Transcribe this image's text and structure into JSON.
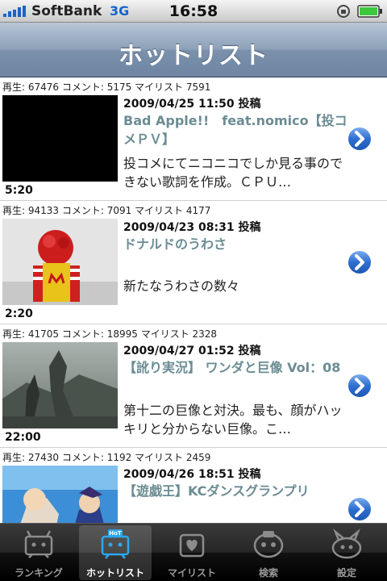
{
  "status_bar": {
    "carrier": "SoftBank",
    "network": "3G",
    "time": "16:58"
  },
  "nav": {
    "title": "ホットリスト"
  },
  "videos": [
    {
      "stats": "再生: 67476 コメント: 5175 マイリスト 7591",
      "date": "2009/04/25 11:50 投稿",
      "title": "Bad Apple!!　feat.nomico【投コメＰＶ】",
      "description": "投コメにてニコニコでしか見る事のできない歌詞を作成。ＣＰＵ…",
      "duration": "5:20"
    },
    {
      "stats": "再生: 94133 コメント: 7091 マイリスト 4177",
      "date": "2009/04/23 08:31 投稿",
      "title": "ドナルドのうわさ",
      "description": "新たなうわさの数々",
      "duration": "2:20"
    },
    {
      "stats": "再生: 41705 コメント: 18995 マイリスト 2328",
      "date": "2009/04/27 01:52 投稿",
      "title": "【訛り実況】 ワンダと巨像 Vol：08",
      "description": "第十二の巨像と対決。最も、顔がハッキリと分からない巨像。こ…",
      "duration": "22:00"
    },
    {
      "stats": "再生: 27430 コメント: 1192 マイリスト 2459",
      "date": "2009/04/26 18:51 投稿",
      "title": "【遊戯王】KCダンスグランプリ",
      "description": "",
      "duration": ""
    }
  ],
  "tabs": [
    {
      "label": "ランキング",
      "icon": "ranking-icon"
    },
    {
      "label": "ホットリスト",
      "icon": "hotlist-icon",
      "selected": true
    },
    {
      "label": "マイリスト",
      "icon": "mylist-icon"
    },
    {
      "label": "検索",
      "icon": "search-icon"
    },
    {
      "label": "設定",
      "icon": "settings-icon"
    }
  ],
  "colors": {
    "title_text": "#6b8c93",
    "nav_bar": "#7b91ac",
    "tab_bar": "#1a1a1a",
    "chevron": "#2f6fd0"
  }
}
